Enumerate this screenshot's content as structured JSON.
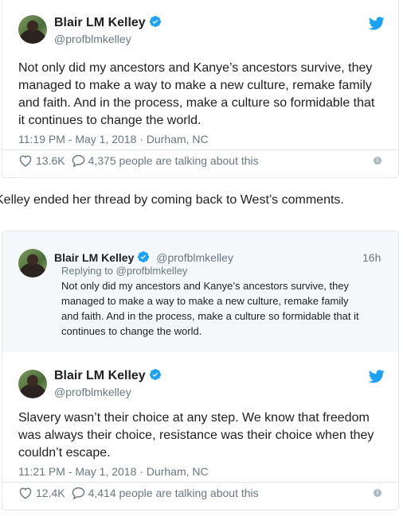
{
  "tweet1": {
    "name": "Blair LM Kelley",
    "handle": "@profblmkelley",
    "text": "Not only did my ancestors and Kanye’s ancestors survive, they\nmanaged to make a way to make a new culture, remake family\nand faith. And in the process, make a culture so formidable that\nit continues to change the world.",
    "timestamp": "11:19 PM - May 1, 2018 · Durham, NC",
    "likes": "13.6K",
    "talking": "4,375 people are talking about this"
  },
  "caption": "Kelley ended her thread by coming back to West’s comments.",
  "reply_context": {
    "name": "Blair LM Kelley",
    "handle": "@profblmkelley",
    "age": "16h",
    "replying_to": "Replying to @profblmkelley",
    "text": "Not only did my ancestors and Kanye’s ancestors survive, they\nmanaged to make a way to make a new culture, remake family\nand faith. And in the process, make a culture so formidable that it\ncontinues to change the world."
  },
  "tweet2": {
    "name": "Blair LM Kelley",
    "handle": "@profblmkelley",
    "text": "Slavery wasn’t their choice at any step. We know that freedom\nwas always their choice, resistance was their choice when they\ncouldn’t escape.",
    "timestamp": "11:21 PM - May 1, 2018 · Durham, NC",
    "likes": "12.4K",
    "talking": "4,414 people are talking about this"
  },
  "icons": {
    "verified_color": "#1da1f2",
    "twitter_color": "#1da1f2",
    "info_glyph": "i"
  }
}
